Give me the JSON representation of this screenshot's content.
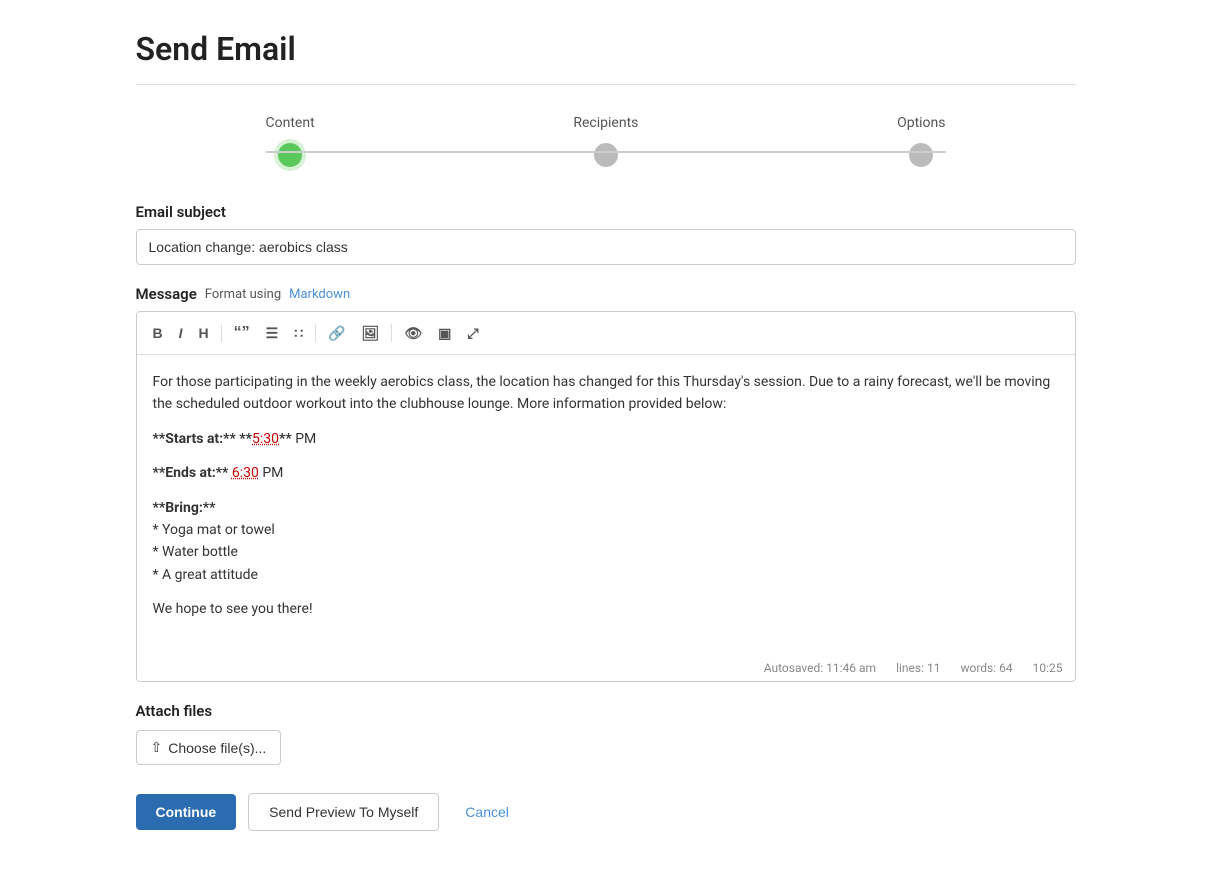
{
  "page": {
    "title": "Send Email"
  },
  "stepper": {
    "steps": [
      {
        "id": "content",
        "label": "Content",
        "state": "active"
      },
      {
        "id": "recipients",
        "label": "Recipients",
        "state": "inactive"
      },
      {
        "id": "options",
        "label": "Options",
        "state": "inactive"
      }
    ]
  },
  "email_subject": {
    "label": "Email subject",
    "value": "Location change: aerobics class",
    "placeholder": "Location change: aerobics class"
  },
  "message": {
    "label": "Message",
    "format_text": "Format using",
    "markdown_link_label": "Markdown",
    "toolbar": {
      "bold": "B",
      "italic": "I",
      "heading": "H",
      "quote": "“”",
      "unordered_list": "•≡",
      "ordered_list": "1≡",
      "link": "🔗",
      "image": "🖼",
      "preview": "👁",
      "split": "▣",
      "fullscreen": "⤢"
    },
    "body": "For those participating in the weekly aerobics class, the location has changed for this Thursday's session. Due to a rainy forecast, we'll be moving the scheduled outdoor workout into the clubhouse lounge. More information provided below:\n\n**Starts at:** **5:30** PM\n**Ends at:** **6:30** PM\n\n**Bring:**\n* Yoga mat or towel\n* Water bottle\n* A great attitude\n\nWe hope to see you there!",
    "autosave_text": "Autosaved: 11:46 am",
    "lines_label": "lines: 11",
    "words_label": "words: 64",
    "time_label": "10:25"
  },
  "attach_files": {
    "label": "Attach files",
    "button_label": "Choose file(s)..."
  },
  "actions": {
    "continue_label": "Continue",
    "preview_label": "Send Preview To Myself",
    "cancel_label": "Cancel"
  }
}
